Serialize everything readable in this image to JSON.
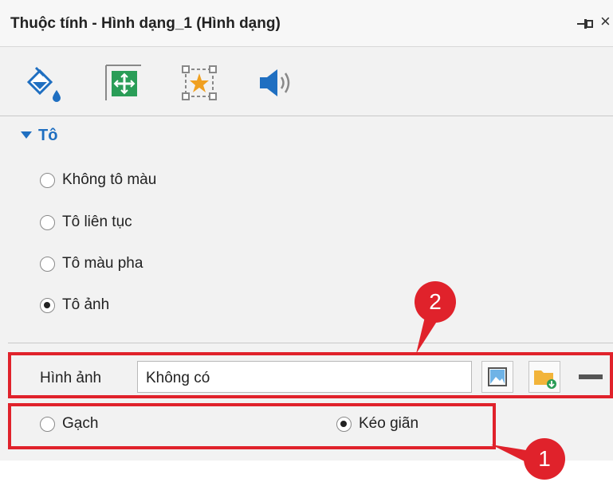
{
  "window": {
    "title": "Thuộc tính - Hình dạng_1 (Hình dạng)",
    "pin_icon": "pin-icon",
    "close_label": "×"
  },
  "tabs": [
    {
      "icon": "fill-bucket-icon",
      "selected": true
    },
    {
      "icon": "shape-size-icon",
      "selected": false
    },
    {
      "icon": "star-effect-icon",
      "selected": false
    },
    {
      "icon": "speaker-sound-icon",
      "selected": false
    }
  ],
  "fill_section": {
    "title": "Tô",
    "options": [
      {
        "label": "Không tô màu",
        "checked": false
      },
      {
        "label": "Tô liên tục",
        "checked": false
      },
      {
        "label": "Tô màu pha",
        "checked": false
      },
      {
        "label": "Tô ảnh",
        "checked": true
      }
    ]
  },
  "picture": {
    "label": "Hình ảnh",
    "value": "Không có",
    "buttons": [
      {
        "icon": "image-picker-icon"
      },
      {
        "icon": "folder-open-icon"
      },
      {
        "icon": "minus-icon"
      }
    ]
  },
  "mode": {
    "options": [
      {
        "label": "Gạch",
        "checked": false
      },
      {
        "label": "Kéo giãn",
        "checked": true
      }
    ]
  },
  "callouts": [
    "1",
    "2"
  ],
  "colors": {
    "accent": "#1f6fc1",
    "highlight": "#e0222b",
    "panel": "#f2f2f2"
  }
}
